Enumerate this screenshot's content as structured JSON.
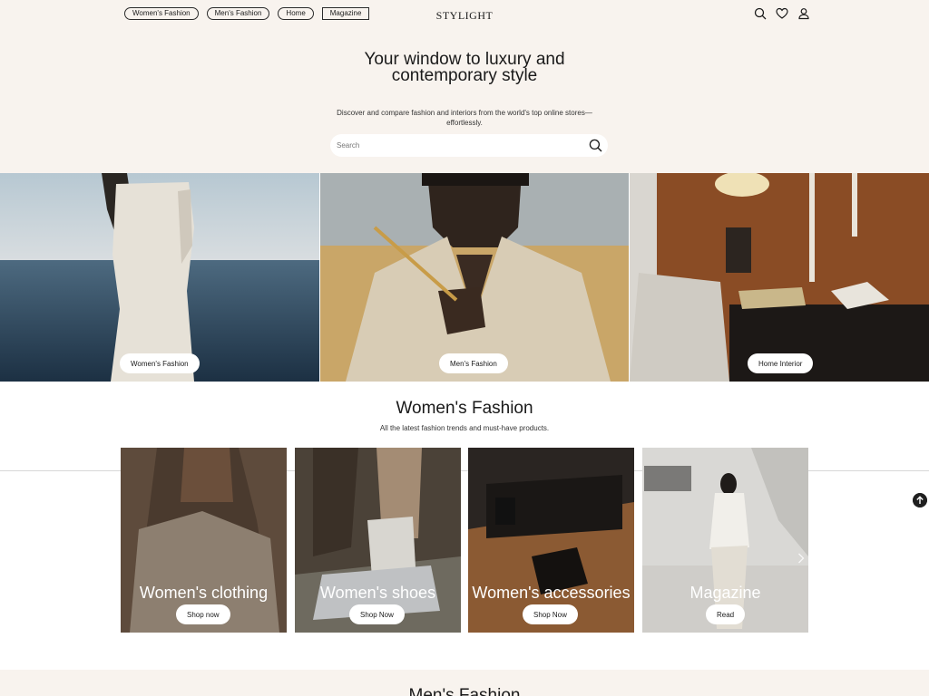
{
  "header": {
    "logo": "STYLIGHT",
    "nav": [
      "Women's Fashion",
      "Men's Fashion",
      "Home",
      "Magazine"
    ],
    "icons": [
      "search-icon",
      "heart-icon",
      "user-icon"
    ]
  },
  "hero": {
    "title_line1": "Your window to luxury and",
    "title_line2": "contemporary style",
    "subtitle_line1": "Discover and compare fashion and interiors from the world's top online stores—",
    "subtitle_line2": "effortlessly.",
    "search_placeholder": "Search"
  },
  "categories": [
    "Women's Fashion",
    "Men's Fashion",
    "Home Interior"
  ],
  "womens_section": {
    "title": "Women's Fashion",
    "subtitle": "All the latest fashion trends and must-have products.",
    "cards": [
      {
        "title": "Women's clothing",
        "button": "Shop now"
      },
      {
        "title": "Women's shoes",
        "button": "Shop Now"
      },
      {
        "title": "Women's accessories",
        "button": "Shop Now"
      },
      {
        "title": "Magazine",
        "button": "Read"
      }
    ]
  },
  "next_section": {
    "title": "Men's Fashion"
  },
  "colors": {
    "cream": "#f8f3ee",
    "ink": "#1a1a1a"
  }
}
